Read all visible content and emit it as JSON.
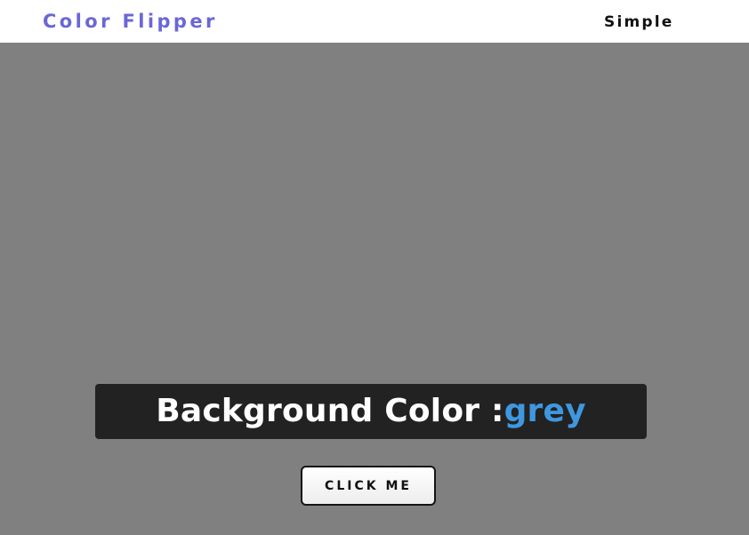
{
  "navbar": {
    "brand": "Color Flipper",
    "link_simple": "Simple"
  },
  "main": {
    "label": "Background Color :",
    "color_value": "grey",
    "button_label": "CLICK ME"
  },
  "colors": {
    "background": "#808080",
    "brand": "#6b67d6",
    "panel": "#222222",
    "color_value": "#3f97e0"
  }
}
